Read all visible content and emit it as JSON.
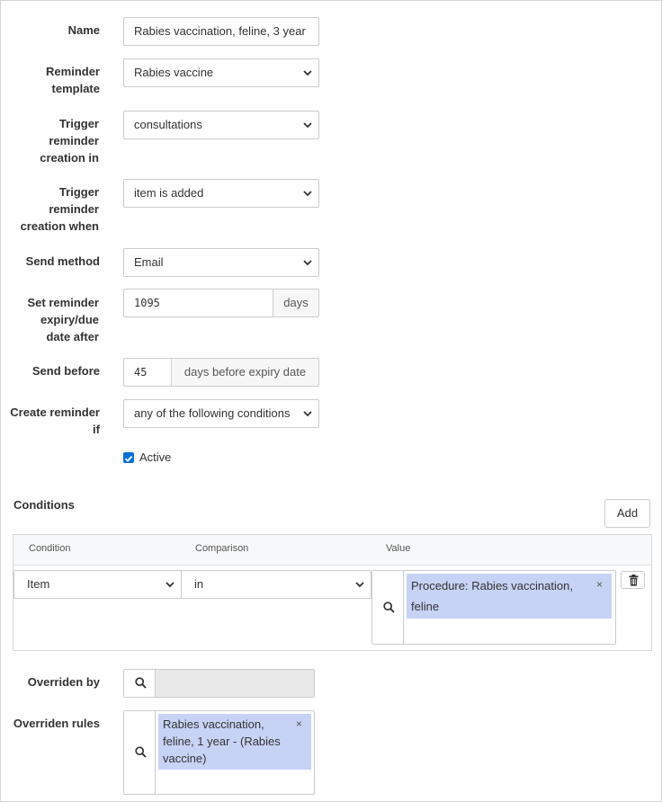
{
  "form": {
    "name_label": "Name",
    "name_value": "Rabies vaccination, feline, 3 year",
    "reminder_template_label": "Reminder template",
    "reminder_template_value": "Rabies vaccine",
    "trigger_in_label": "Trigger reminder creation in",
    "trigger_in_value": "consultations",
    "trigger_when_label": "Trigger reminder creation when",
    "trigger_when_value": "item is added",
    "send_method_label": "Send method",
    "send_method_value": "Email",
    "expiry_label": "Set reminder expiry/due date after",
    "expiry_value": "1095",
    "expiry_unit": "days",
    "send_before_label": "Send before",
    "send_before_value": "45",
    "send_before_unit": "days before expiry date",
    "create_if_label": "Create reminder if",
    "create_if_value": "any of the following conditions",
    "active_label": "Active",
    "active_checked": true
  },
  "conditions": {
    "title": "Conditions",
    "add_label": "Add",
    "columns": [
      "Condition",
      "Comparison",
      "Value"
    ],
    "rows": [
      {
        "condition": "Item",
        "comparison": "in",
        "value_tag_line1": "Procedure: Rabies vaccination,",
        "value_tag_line2": "feline",
        "remove_symbol": "×"
      }
    ]
  },
  "overrides": {
    "overriden_by_label": "Overriden by",
    "overriden_rules_label": "Overriden rules",
    "rule_tag_line1": "Rabies vaccination,",
    "rule_tag_line2": "feline, 1 year - (Rabies",
    "rule_tag_line3": "vaccine)",
    "remove_symbol": "×"
  },
  "icons": {
    "search": "search-icon",
    "chevron": "chevron-down-icon",
    "trash": "trash-icon",
    "check": "checkmark-icon"
  },
  "colors": {
    "checkbox": "#0a6fd8",
    "tag_bg": "#c7d3f5",
    "disabled_bg": "#e9e9e9"
  }
}
